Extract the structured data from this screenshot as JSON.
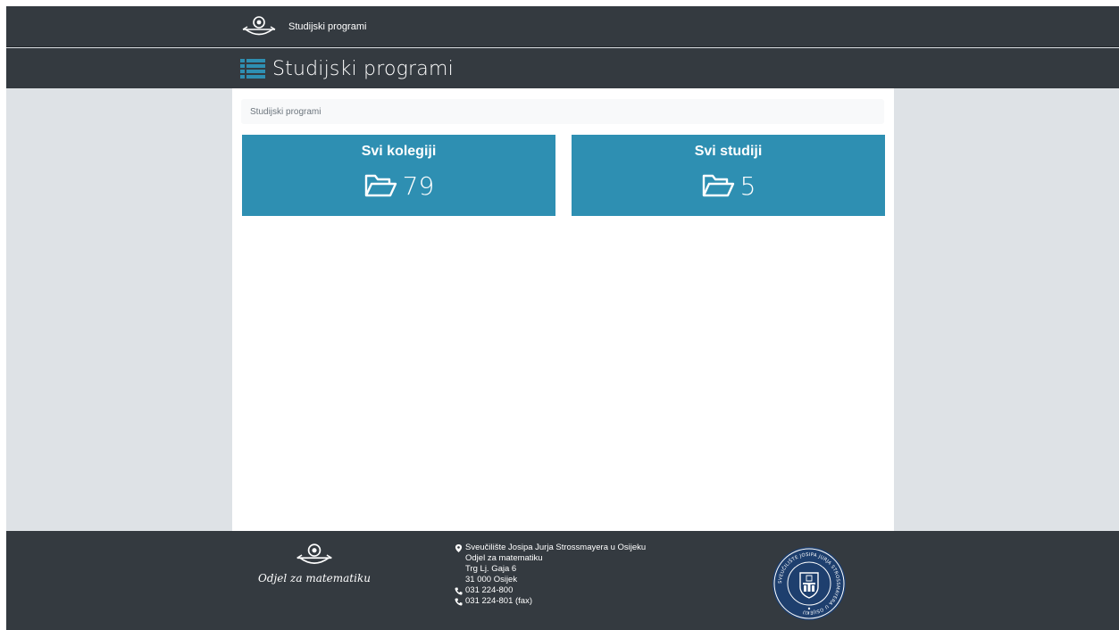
{
  "header": {
    "brand_text": "Studijski programi",
    "brand_logo_icon": "math-department-logo-icon"
  },
  "page": {
    "title": "Studijski programi",
    "title_icon": "list-icon"
  },
  "breadcrumb": {
    "items": [
      "Studijski programi"
    ]
  },
  "cards": [
    {
      "title": "Svi kolegiji",
      "count": "79",
      "icon": "folder-open-icon"
    },
    {
      "title": "Svi studiji",
      "count": "5",
      "icon": "folder-open-icon"
    }
  ],
  "footer": {
    "logo_text": "Odjel za matematiku",
    "address": {
      "university": "Sveučilište Josipa Jurja Strossmayera u Osijeku",
      "department": "Odjel za matematiku",
      "street": "Trg Lj. Gaja 6",
      "city": "31 000 Osijek",
      "phone": "031 224-800",
      "fax": "031 224-801 (fax)"
    },
    "seal_icon": "university-seal-icon",
    "seal_text": "SVEUČILIŠTE JOSIPA JURJA STROSSMAYERA U OSIJEKU"
  },
  "colors": {
    "navbar": "#343a40",
    "card": "#2e8fb2",
    "accent_icon": "#2e8fb2",
    "background": "#dee2e6",
    "breadcrumb_bg": "#f8f9fa"
  }
}
